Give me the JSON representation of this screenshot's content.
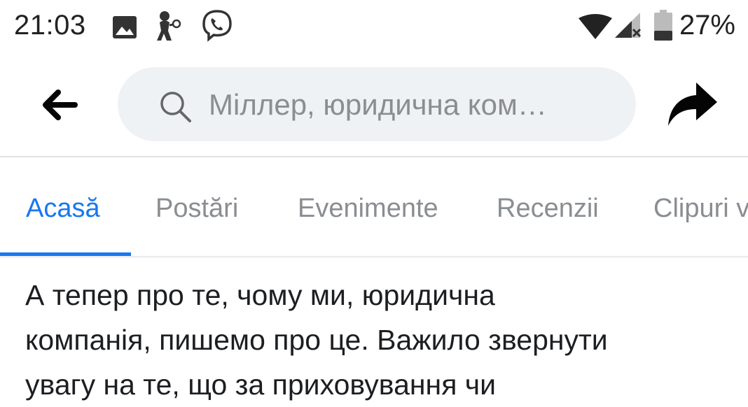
{
  "status_bar": {
    "time": "21:03",
    "battery": "27%",
    "icons": [
      "image-icon",
      "figure-notification-icon",
      "viber-icon",
      "wifi-icon",
      "signal-icon",
      "battery-icon"
    ]
  },
  "header": {
    "search_text": "Міллер, юридична ком…",
    "icons": [
      "back-arrow-icon",
      "search-icon",
      "share-icon"
    ]
  },
  "tabs": [
    {
      "label": "Acasă",
      "active": true
    },
    {
      "label": "Postări",
      "active": false
    },
    {
      "label": "Evenimente",
      "active": false
    },
    {
      "label": "Recenzii",
      "active": false
    },
    {
      "label": "Clipuri v",
      "active": false
    }
  ],
  "post": {
    "lines": [
      "А тепер про те, чому ми, юридична",
      "компанія, пишемо про це. Важило звернути",
      "увагу на те, що за приховування чи"
    ]
  },
  "colors": {
    "accent": "#1877f2",
    "search_bg": "#eff2f5",
    "muted": "#8a8d91",
    "text": "#1c1e21"
  }
}
